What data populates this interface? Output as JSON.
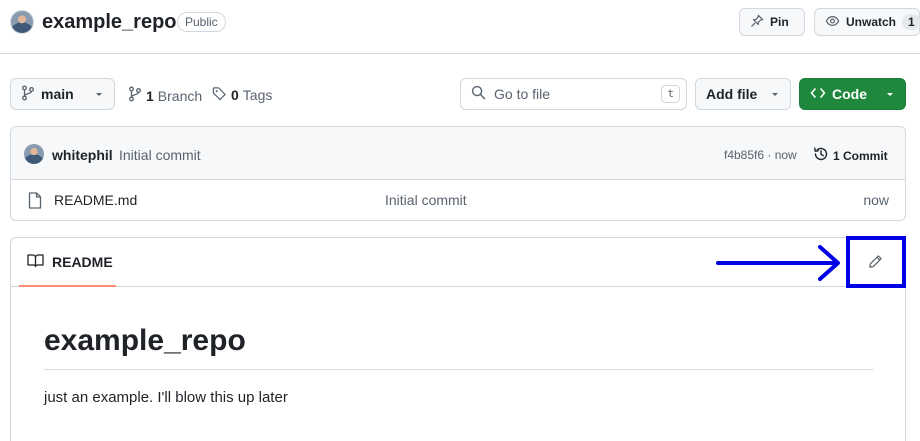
{
  "header": {
    "repo_name": "example_repo",
    "visibility_badge": "Public",
    "pin_label": "Pin",
    "watch_label": "Unwatch",
    "watch_count": "1"
  },
  "toolbar": {
    "branch_name": "main",
    "branch_count": "1",
    "branch_text": "Branch",
    "tag_count": "0",
    "tag_text": "Tags",
    "search_placeholder": "Go to file",
    "search_shortcut": "t",
    "add_file_label": "Add file",
    "code_label": "Code"
  },
  "latest_commit": {
    "author": "whitephil",
    "message": "Initial commit",
    "sha_time": "f4b85f6 · now",
    "commit_count_label": "1 Commit"
  },
  "files": [
    {
      "name": "README.md",
      "commit": "Initial commit",
      "time": "now"
    }
  ],
  "readme": {
    "tab_label": "README",
    "title": "example_repo",
    "body": "just an example. I'll blow this up later"
  },
  "annotation": {
    "color": "#0000e6"
  },
  "colors": {
    "primary_button": "#1f883d",
    "active_tab_underline": "#fd8c73",
    "border": "#d0d7de"
  }
}
